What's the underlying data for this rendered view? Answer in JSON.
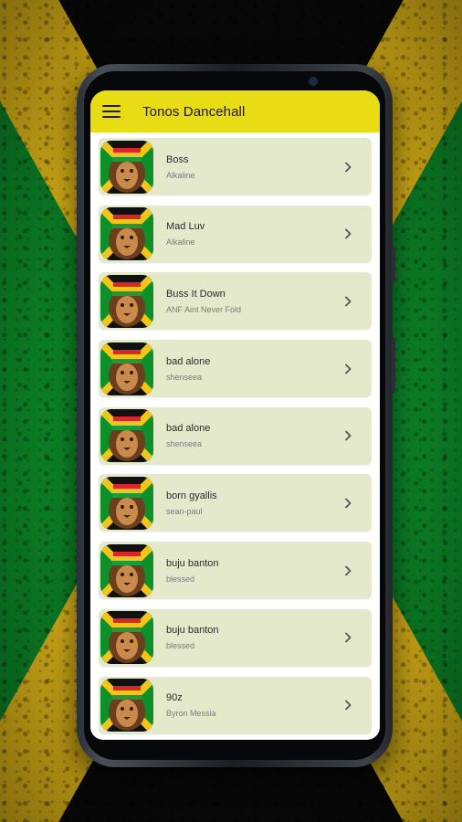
{
  "app": {
    "title": "Tonos Dancehall"
  },
  "colors": {
    "appbar": "#e8dc14",
    "card": "#e5e9cc",
    "flag_green": "#0d8f2a",
    "flag_yellow": "#f2c51a",
    "flag_black": "#0a0a0a"
  },
  "icons": {
    "menu": "hamburger-menu-icon",
    "row_action": "chevron-right-icon",
    "thumbnail": "rasta-lion-icon"
  },
  "songs": [
    {
      "title": "Boss",
      "artist": "Alkaline"
    },
    {
      "title": "Mad Luv",
      "artist": "Alkaline"
    },
    {
      "title": "Buss It Down",
      "artist": "ANF Aint Never Fold"
    },
    {
      "title": "bad alone",
      "artist": "shenseea"
    },
    {
      "title": "bad alone",
      "artist": "shenseea"
    },
    {
      "title": "born gyallis",
      "artist": "sean-paul"
    },
    {
      "title": "buju banton",
      "artist": "blessed"
    },
    {
      "title": "buju banton",
      "artist": "blessed"
    },
    {
      "title": "90z",
      "artist": "Byron Messia"
    }
  ]
}
